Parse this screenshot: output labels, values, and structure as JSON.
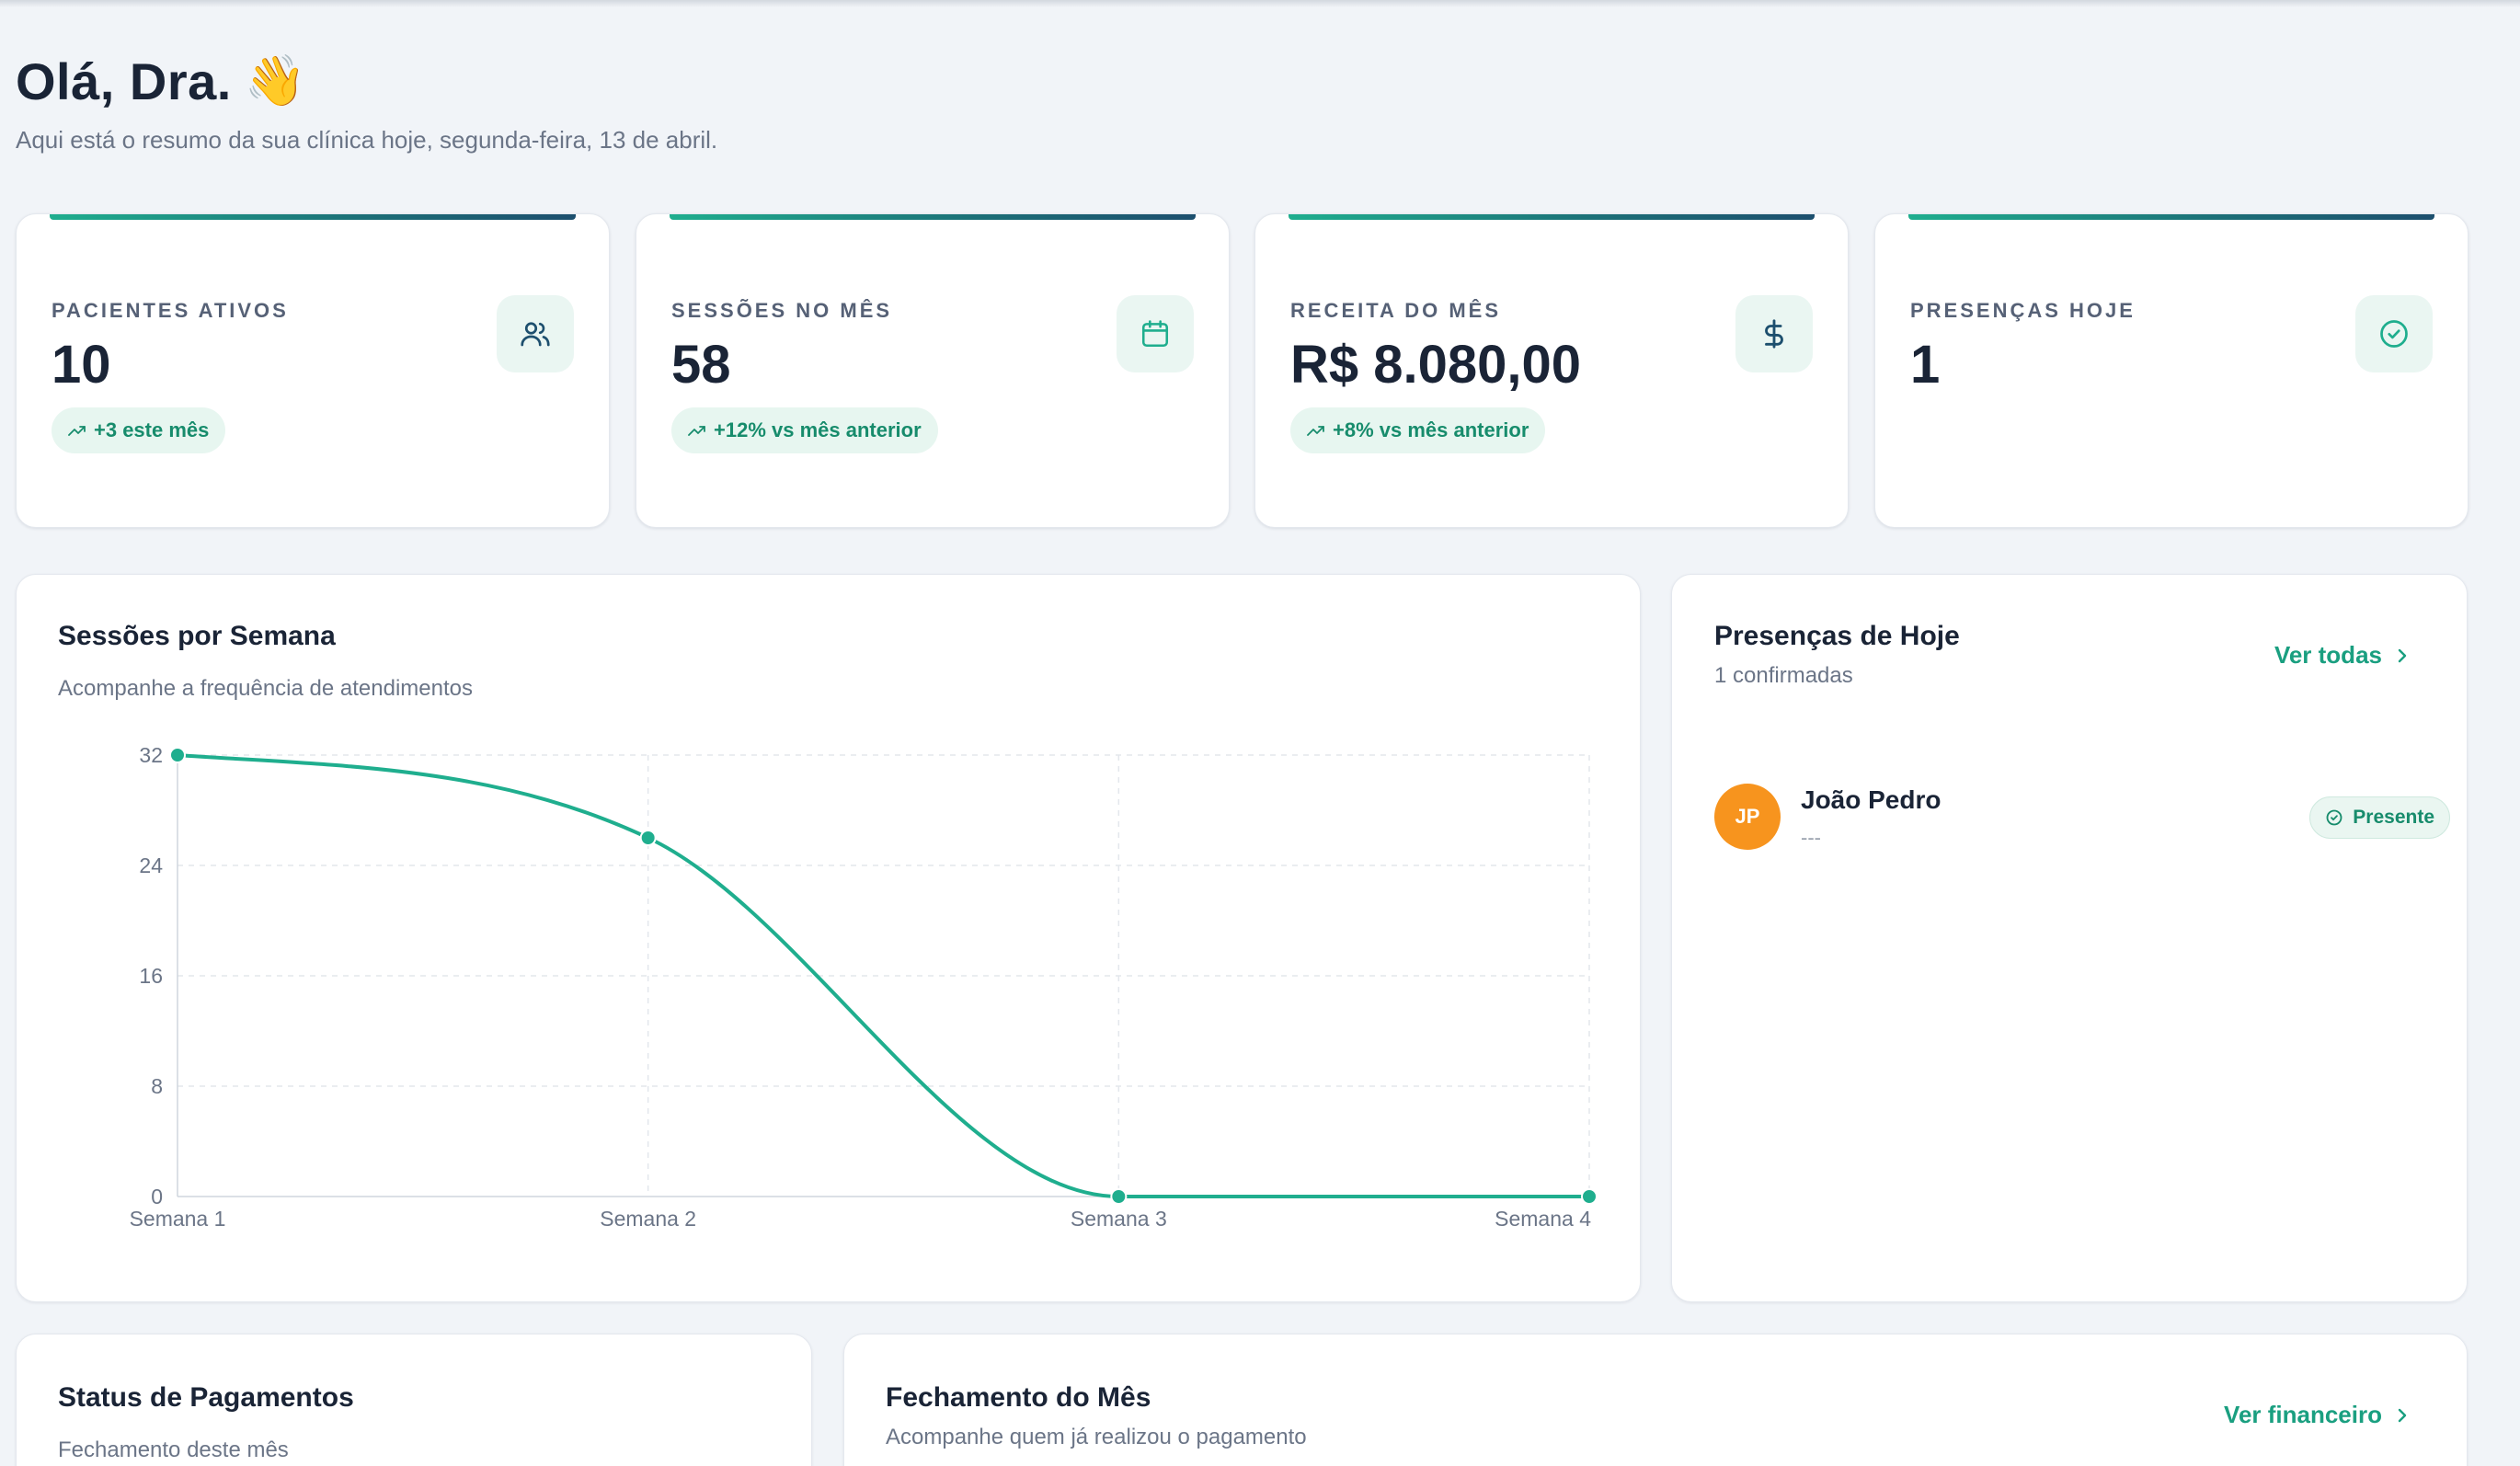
{
  "greeting": {
    "title": "Olá, Dra.",
    "emoji": "👋",
    "subtitle": "Aqui está o resumo da sua clínica hoje, segunda-feira, 13 de abril."
  },
  "stats": [
    {
      "label": "PACIENTES ATIVOS",
      "value": "10",
      "badge": "+3 este mês",
      "icon": "users-icon"
    },
    {
      "label": "SESSÕES NO MÊS",
      "value": "58",
      "badge": "+12% vs mês anterior",
      "icon": "calendar-icon"
    },
    {
      "label": "RECEITA DO MÊS",
      "value": "R$ 8.080,00",
      "badge": "+8% vs mês anterior",
      "icon": "dollar-icon"
    },
    {
      "label": "PRESENÇAS HOJE",
      "value": "1",
      "badge": "",
      "icon": "check-circle-icon"
    }
  ],
  "sessions_chart": {
    "title": "Sessões por Semana",
    "subtitle": "Acompanhe a frequência de atendimentos"
  },
  "chart_data": {
    "type": "line",
    "title": "Sessões por Semana",
    "categories": [
      "Semana 1",
      "Semana 2",
      "Semana 3",
      "Semana 4"
    ],
    "values": [
      32,
      26,
      0,
      0
    ],
    "yticks": [
      "0",
      "8",
      "16",
      "24",
      "32"
    ],
    "ylim": [
      0,
      32
    ],
    "grid": true,
    "curve": "smooth",
    "color": "#1fae8e"
  },
  "presences": {
    "title": "Presenças de Hoje",
    "subtitle": "1 confirmadas",
    "link": "Ver todas",
    "items": [
      {
        "initials": "JP",
        "name": "João Pedro",
        "detail": "---",
        "status": "Presente"
      }
    ]
  },
  "payments": {
    "title": "Status de Pagamentos",
    "subtitle": "Fechamento deste mês"
  },
  "closing": {
    "title": "Fechamento do Mês",
    "subtitle": "Acompanhe quem já realizou o pagamento",
    "link": "Ver financeiro"
  },
  "colors": {
    "accent": "#1fae8e",
    "accent_dark": "#1d4f6e",
    "avatar": "#f7941e",
    "background": "#f1f4f8"
  }
}
